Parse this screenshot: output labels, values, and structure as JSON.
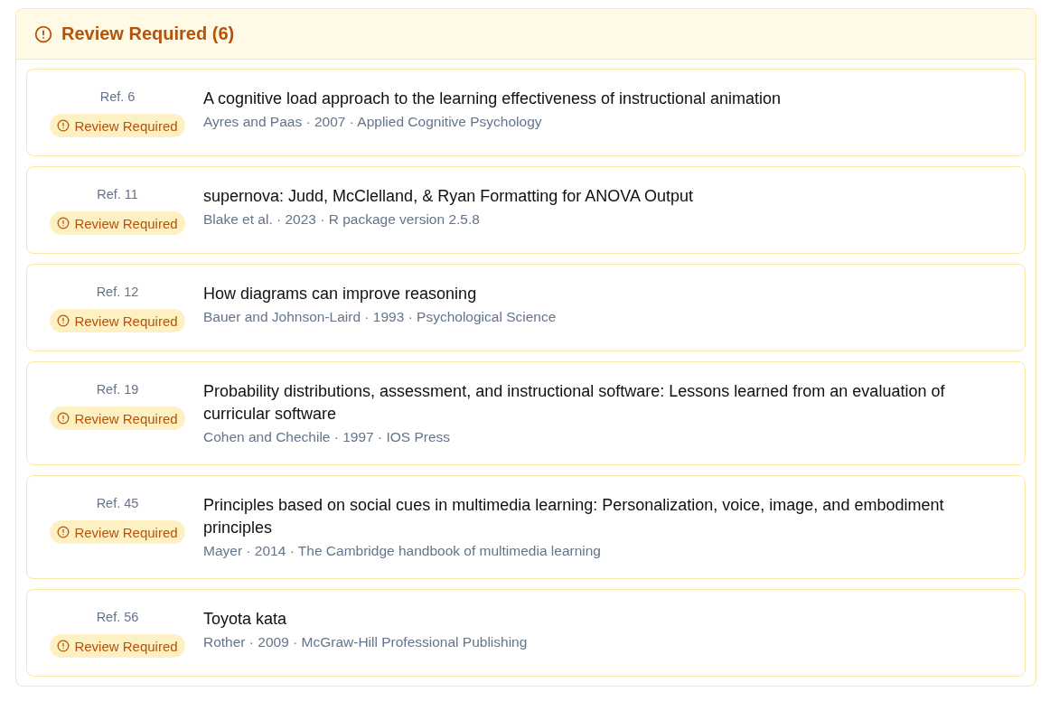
{
  "panel": {
    "title": "Review Required (6)",
    "kind": "warning"
  },
  "references": [
    {
      "ref": "Ref. 6",
      "badge": {
        "label": "Review Required",
        "kind": "warning"
      },
      "title": "A cognitive load approach to the learning effectiveness of instructional animation",
      "meta": "Ayres and Paas · 2007 · Applied Cognitive Psychology"
    },
    {
      "ref": "Ref. 11",
      "badge": {
        "label": "Review Required",
        "kind": "warning"
      },
      "title": "supernova: Judd, McClelland, & Ryan Formatting for ANOVA Output",
      "meta": "Blake et al. · 2023 · R package version 2.5.8"
    },
    {
      "ref": "Ref. 12",
      "badge": {
        "label": "Review Required",
        "kind": "warning"
      },
      "title": "How diagrams can improve reasoning",
      "meta": "Bauer and Johnson-Laird · 1993 · Psychological Science"
    },
    {
      "ref": "Ref. 19",
      "badge": {
        "label": "Review Required",
        "kind": "warning"
      },
      "title": "Probability distributions, assessment, and instructional software: Lessons learned from an evaluation of curricular software",
      "meta": "Cohen and Chechile · 1997 · IOS Press"
    },
    {
      "ref": "Ref. 45",
      "badge": {
        "label": "Review Required",
        "kind": "warning"
      },
      "title": "Principles based on social cues in multimedia learning: Personalization, voice, image, and embodiment principles",
      "meta": "Mayer · 2014 · The Cambridge handbook of multimedia learning"
    },
    {
      "ref": "Ref. 56",
      "badge": {
        "label": "Review Required",
        "kind": "warning"
      },
      "title": "Toyota kata",
      "meta": "Rother · 2009 · McGraw-Hill Professional Publishing"
    }
  ]
}
